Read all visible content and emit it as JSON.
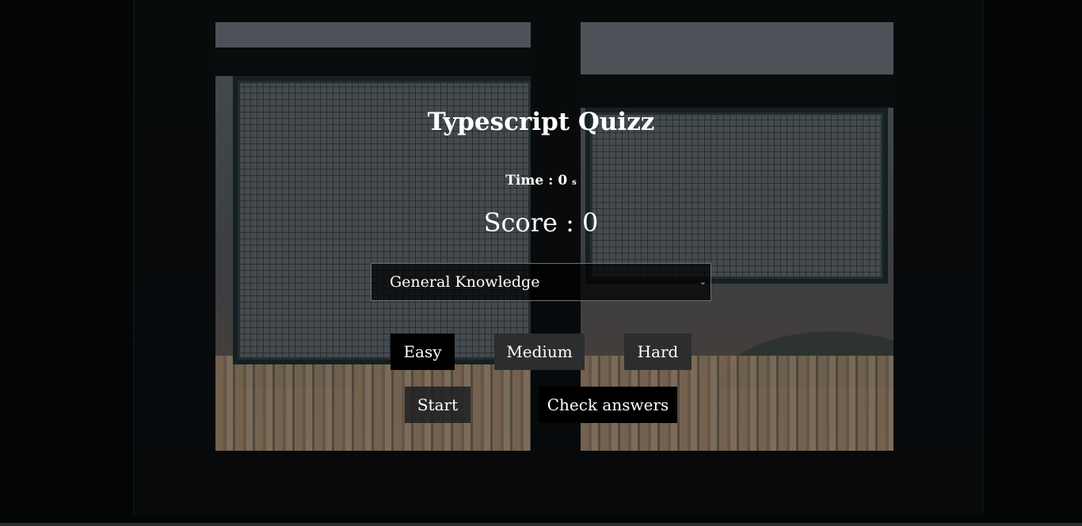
{
  "app": {
    "title": "Typescript Quizz"
  },
  "stats": {
    "time_label": "Time : ",
    "time_value": "0",
    "time_unit": "s",
    "score_label": "Score : ",
    "score_value": "0"
  },
  "category": {
    "selected": "General Knowledge",
    "chevron": "⌄"
  },
  "difficulty": {
    "easy": "Easy",
    "medium": "Medium",
    "hard": "Hard"
  },
  "actions": {
    "start": "Start",
    "check": "Check answers"
  },
  "colors": {
    "text": "#ffffff",
    "button_active": "#000000",
    "button_inactive": "#2b2d2e"
  }
}
